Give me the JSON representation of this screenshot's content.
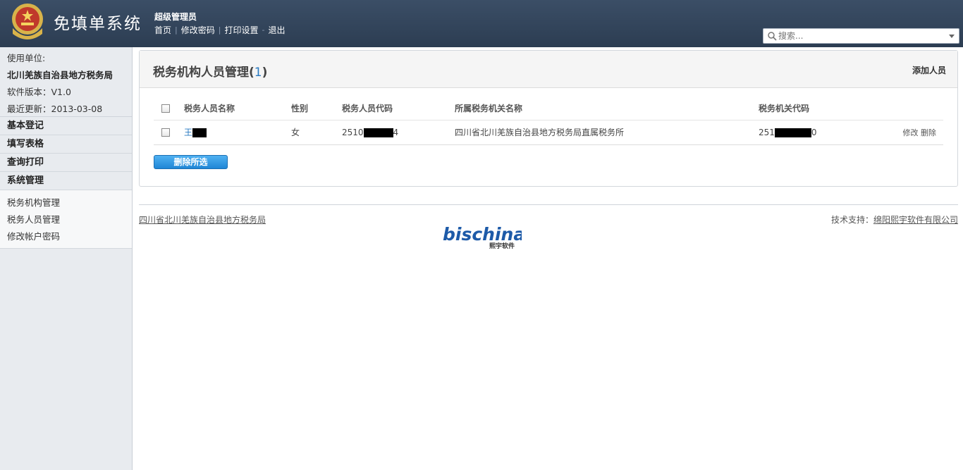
{
  "header": {
    "app_title": "免填单系统",
    "user_role": "超级管理员",
    "nav": [
      "首页",
      "修改密码",
      "打印设置",
      "退出"
    ],
    "search_placeholder": "搜索..."
  },
  "sidebar": {
    "unit_label": "使用单位:",
    "unit_name": "北川羌族自治县地方税务局",
    "version": "软件版本：V1.0",
    "updated": "最近更新：2013-03-08",
    "sections": [
      "基本登记",
      "填写表格",
      "查询打印",
      "系统管理"
    ],
    "sub_items": [
      "税务机构管理",
      "税务人员管理",
      "修改帐户密码"
    ]
  },
  "panel": {
    "title": "税务机构人员管理(",
    "count": "1",
    "title_end": ")",
    "add_label": "添加人员",
    "columns": [
      "税务人员名称",
      "性别",
      "税务人员代码",
      "所属税务机关名称",
      "税务机关代码"
    ],
    "rows": [
      {
        "name_prefix": "王",
        "gender": "女",
        "code_prefix": "2510",
        "code_suffix": "4",
        "org_name": "四川省北川羌族自治县地方税务局直属税务所",
        "org_code_prefix": "251",
        "org_code_suffix": "0",
        "edit": "修改",
        "delete": "删除"
      }
    ],
    "delete_selected": "删除所选"
  },
  "footer": {
    "left": "四川省北川羌族自治县地方税务局",
    "support_label": "技术支持：",
    "support_company": "绵阳熙宇软件有限公司",
    "brand_text": "bischina",
    "brand_sub": "熙宇软件"
  },
  "colors": {
    "header": "#2f4157",
    "accent": "#2a7bc2",
    "button": "#1f86d6"
  }
}
